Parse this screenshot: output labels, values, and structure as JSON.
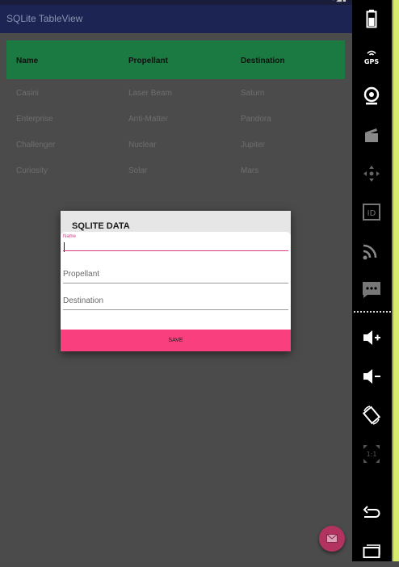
{
  "app": {
    "title": "SQLite TableView"
  },
  "table": {
    "headers": [
      "Name",
      "Propellant",
      "Destination"
    ],
    "rows": [
      [
        "Casini",
        "Laser Beam",
        "Saturn"
      ],
      [
        "Enterprise",
        "Anti-Matter",
        "Pandora"
      ],
      [
        "Challenger",
        "Nuclear",
        "Jupiter"
      ],
      [
        "Curiosity",
        "Solar",
        "Mars"
      ]
    ]
  },
  "dialog": {
    "title": "SQLITE DATA",
    "name_label": "Name",
    "propellant_placeholder": "Propellant",
    "destination_placeholder": "Destination",
    "save_label": "SAVE"
  },
  "emulator_sidebar": {
    "gps_label": "GPS",
    "id_label": "ID",
    "scale_label": "1:1",
    "icons": [
      "battery-icon",
      "gps-icon",
      "camera-icon",
      "video-icon",
      "dpad-icon",
      "id-icon",
      "rss-icon",
      "sms-icon",
      "volume-up-icon",
      "volume-down-icon",
      "rotate-icon",
      "scale-icon",
      "back-icon",
      "recents-icon"
    ]
  },
  "colors": {
    "appbar": "#1b2452",
    "table_header": "#1b7a42",
    "accent": "#fa3f7f",
    "fab": "#b33360"
  }
}
